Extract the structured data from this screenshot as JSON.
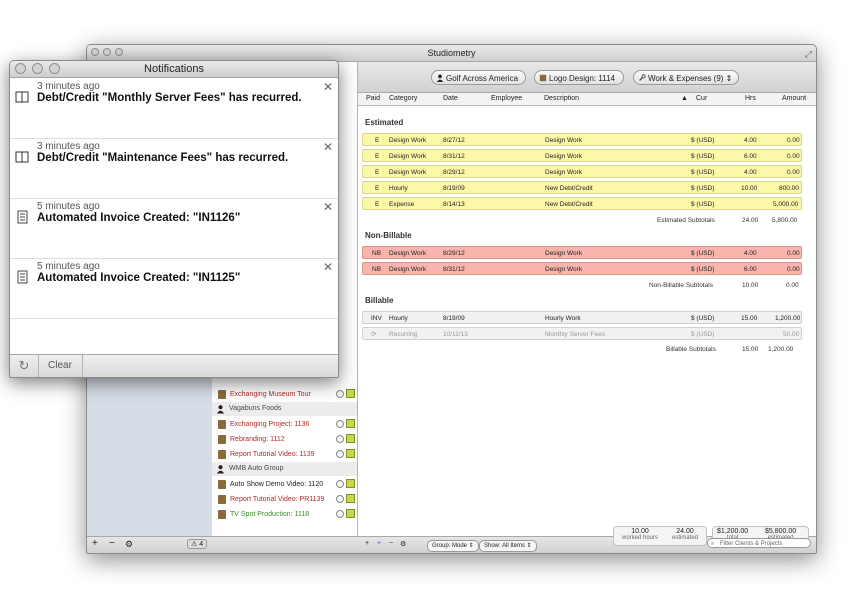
{
  "main_window": {
    "title": "Studiometry"
  },
  "toolbar": {
    "client": "Golf Across America",
    "project": "Logo Design: 1114",
    "view": "Work & Expenses (9)"
  },
  "columns": [
    "Paid",
    "Category",
    "Date",
    "Employee",
    "Description",
    "Cur",
    "Hrs",
    "Amount"
  ],
  "sections": {
    "estimated": {
      "title": "Estimated",
      "rows": [
        {
          "paid": "E",
          "category": "Design Work",
          "date": "8/27/12",
          "description": "Design Work",
          "cur": "$ (USD)",
          "hrs": "4.00",
          "amount": "0.00"
        },
        {
          "paid": "E",
          "category": "Design Work",
          "date": "8/31/12",
          "description": "Design Work",
          "cur": "$ (USD)",
          "hrs": "6.00",
          "amount": "0.00"
        },
        {
          "paid": "E",
          "category": "Design Work",
          "date": "8/29/12",
          "description": "Design Work",
          "cur": "$ (USD)",
          "hrs": "4.00",
          "amount": "0.00"
        },
        {
          "paid": "E",
          "category": "Hourly",
          "date": "8/19/09",
          "description": "New Debt/Credit",
          "cur": "$ (USD)",
          "hrs": "10.00",
          "amount": "800.00"
        },
        {
          "paid": "E",
          "category": "Expense",
          "date": "8/14/13",
          "description": "New Debt/Credit",
          "cur": "$ (USD)",
          "hrs": "",
          "amount": "5,000.00"
        }
      ],
      "subtotal_label": "Estimated Subtotals",
      "subtotal_hrs": "24.00",
      "subtotal_amount": "5,800.00"
    },
    "nonbillable": {
      "title": "Non-Billable",
      "rows": [
        {
          "paid": "NB",
          "category": "Design Work",
          "date": "8/29/12",
          "description": "Design Work",
          "cur": "$ (USD)",
          "hrs": "4.00",
          "amount": "0.00"
        },
        {
          "paid": "NB",
          "category": "Design Work",
          "date": "8/31/12",
          "description": "Design Work",
          "cur": "$ (USD)",
          "hrs": "6.00",
          "amount": "0.00"
        }
      ],
      "subtotal_label": "Non-Billable Subtotals",
      "subtotal_hrs": "10.00",
      "subtotal_amount": "0.00"
    },
    "billable": {
      "title": "Billable",
      "rows": [
        {
          "paid": "INV",
          "category": "Hourly",
          "date": "8/19/09",
          "description": "Hourly Work",
          "cur": "$ (USD)",
          "hrs": "15.00",
          "amount": "1,200.00"
        },
        {
          "paid": "",
          "category": "Recurring",
          "date": "10/11/13",
          "description": "Monthly Server Fees",
          "cur": "$ (USD)",
          "hrs": "",
          "amount": "50.00"
        }
      ],
      "subtotal_label": "Billable Subtotals",
      "subtotal_hrs": "15.00",
      "subtotal_amount": "1,200.00"
    }
  },
  "projects_list": {
    "partial_top": "Exchanging Museum Tour",
    "clients": [
      {
        "name": "Vagabuns Foods",
        "projects": [
          {
            "label": "Exchanging Project: 1136",
            "color": "#b02a2a"
          },
          {
            "label": "Rebranding: 1112",
            "color": "#b02a2a"
          },
          {
            "label": "Report Tutorial Video: 1139",
            "color": "#b02a2a"
          }
        ]
      },
      {
        "name": "WMB Auto Group",
        "projects": [
          {
            "label": "Auto Show Demo Video: 1120",
            "color": "#222222"
          },
          {
            "label": "Report Tutorial Video: PR1139",
            "color": "#b02a2a"
          },
          {
            "label": "TV Spot Production: 1118",
            "color": "#3a8a2a"
          }
        ]
      }
    ]
  },
  "bottom_bar": {
    "warning_count": "4",
    "group_mode": "Group: Mode",
    "show_filter": "Show: All Items",
    "worked_hours_value": "10.00",
    "worked_hours_label": "worked hours",
    "estimated_hours_value": "24.00",
    "estimated_hours_label": "estimated",
    "total_value": "$1,200.00",
    "total_label": "total",
    "estimated_total_value": "$5,800.00",
    "estimated_total_label": "estimated",
    "filter_placeholder": "Filter Clients & Projects"
  },
  "notifications": {
    "title": "Notifications",
    "items": [
      {
        "when": "3 minutes ago",
        "message": "Debt/Credit \"Monthly Server Fees\" has recurred.",
        "icon": "book-icon"
      },
      {
        "when": "3 minutes ago",
        "message": "Debt/Credit \"Maintenance Fees\" has recurred.",
        "icon": "book-icon"
      },
      {
        "when": "5 minutes ago",
        "message": "Automated Invoice Created: \"IN1126\"",
        "icon": "document-icon"
      },
      {
        "when": "5 minutes ago",
        "message": "Automated Invoice Created: \"IN1125\"",
        "icon": "document-icon"
      }
    ],
    "clear_label": "Clear"
  }
}
